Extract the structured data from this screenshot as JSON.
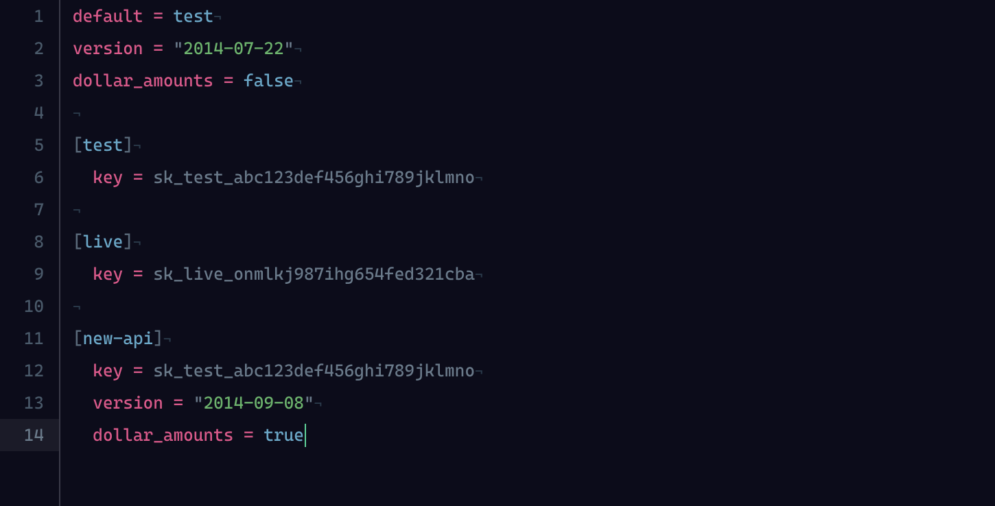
{
  "editor": {
    "current_line": 14,
    "lines": [
      {
        "num": "1",
        "indent": 0,
        "tokens": [
          {
            "t": "default",
            "c": "tok-key"
          },
          {
            "t": " ",
            "c": "tok-ws"
          },
          {
            "t": "=",
            "c": "tok-eq"
          },
          {
            "t": " ",
            "c": "tok-ws"
          },
          {
            "t": "test",
            "c": "tok-ident"
          }
        ]
      },
      {
        "num": "2",
        "indent": 0,
        "tokens": [
          {
            "t": "version",
            "c": "tok-key"
          },
          {
            "t": " ",
            "c": "tok-ws"
          },
          {
            "t": "=",
            "c": "tok-eq"
          },
          {
            "t": " ",
            "c": "tok-ws"
          },
          {
            "t": "\"",
            "c": "tok-str-q"
          },
          {
            "t": "2014-07-22",
            "c": "tok-str"
          },
          {
            "t": "\"",
            "c": "tok-str-q"
          }
        ]
      },
      {
        "num": "3",
        "indent": 0,
        "tokens": [
          {
            "t": "dollar_amounts",
            "c": "tok-key"
          },
          {
            "t": " ",
            "c": "tok-ws"
          },
          {
            "t": "=",
            "c": "tok-eq"
          },
          {
            "t": " ",
            "c": "tok-ws"
          },
          {
            "t": "false",
            "c": "tok-bool"
          }
        ]
      },
      {
        "num": "4",
        "indent": 0,
        "tokens": []
      },
      {
        "num": "5",
        "indent": 0,
        "tokens": [
          {
            "t": "[",
            "c": "tok-bracket"
          },
          {
            "t": "test",
            "c": "tok-section"
          },
          {
            "t": "]",
            "c": "tok-bracket"
          }
        ]
      },
      {
        "num": "6",
        "indent": 1,
        "tokens": [
          {
            "t": "key",
            "c": "tok-key"
          },
          {
            "t": " ",
            "c": "tok-ws"
          },
          {
            "t": "=",
            "c": "tok-eq"
          },
          {
            "t": " ",
            "c": "tok-ws"
          },
          {
            "t": "sk_test_abc123def456ghi789jklmno",
            "c": "tok-plain"
          }
        ]
      },
      {
        "num": "7",
        "indent": 0,
        "tokens": []
      },
      {
        "num": "8",
        "indent": 0,
        "tokens": [
          {
            "t": "[",
            "c": "tok-bracket"
          },
          {
            "t": "live",
            "c": "tok-section"
          },
          {
            "t": "]",
            "c": "tok-bracket"
          }
        ]
      },
      {
        "num": "9",
        "indent": 1,
        "tokens": [
          {
            "t": "key",
            "c": "tok-key"
          },
          {
            "t": " ",
            "c": "tok-ws"
          },
          {
            "t": "=",
            "c": "tok-eq"
          },
          {
            "t": " ",
            "c": "tok-ws"
          },
          {
            "t": "sk_live_onmlkj987ihg654fed321cba",
            "c": "tok-plain"
          }
        ]
      },
      {
        "num": "10",
        "indent": 0,
        "tokens": []
      },
      {
        "num": "11",
        "indent": 0,
        "tokens": [
          {
            "t": "[",
            "c": "tok-bracket"
          },
          {
            "t": "new-api",
            "c": "tok-section"
          },
          {
            "t": "]",
            "c": "tok-bracket"
          }
        ]
      },
      {
        "num": "12",
        "indent": 1,
        "tokens": [
          {
            "t": "key",
            "c": "tok-key"
          },
          {
            "t": " ",
            "c": "tok-ws"
          },
          {
            "t": "=",
            "c": "tok-eq"
          },
          {
            "t": " ",
            "c": "tok-ws"
          },
          {
            "t": "sk_test_abc123def456ghi789jklmno",
            "c": "tok-plain"
          }
        ]
      },
      {
        "num": "13",
        "indent": 1,
        "tokens": [
          {
            "t": "version",
            "c": "tok-key"
          },
          {
            "t": " ",
            "c": "tok-ws"
          },
          {
            "t": "=",
            "c": "tok-eq"
          },
          {
            "t": " ",
            "c": "tok-ws"
          },
          {
            "t": "\"",
            "c": "tok-str-q"
          },
          {
            "t": "2014-09-08",
            "c": "tok-str"
          },
          {
            "t": "\"",
            "c": "tok-str-q"
          }
        ]
      },
      {
        "num": "14",
        "indent": 1,
        "cursor_after": true,
        "tokens": [
          {
            "t": "dollar_amounts",
            "c": "tok-key"
          },
          {
            "t": " ",
            "c": "tok-ws"
          },
          {
            "t": "=",
            "c": "tok-eq"
          },
          {
            "t": " ",
            "c": "tok-ws"
          },
          {
            "t": "true",
            "c": "tok-bool"
          }
        ]
      }
    ]
  }
}
